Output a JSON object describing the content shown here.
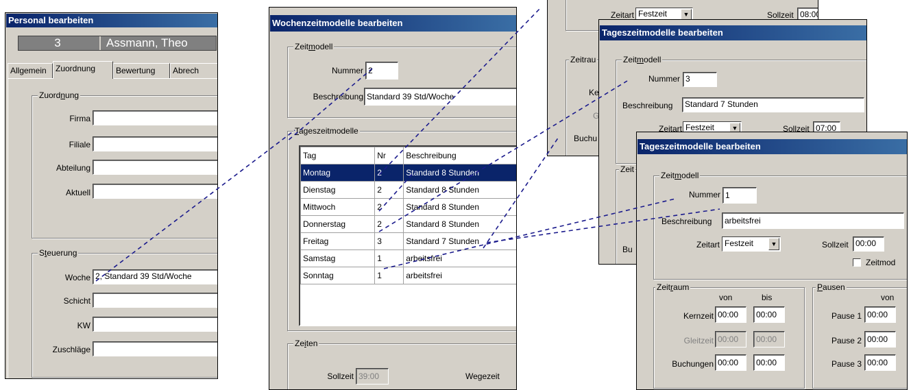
{
  "personal": {
    "title": "Personal bearbeiten",
    "number": "3",
    "name": "Assmann, Theo",
    "tabs": [
      "Allgemein",
      "Zuordnung",
      "Bewertung",
      "Abrech"
    ],
    "zuordnung_group": "Zuordnung",
    "fields": [
      {
        "label": "Firma",
        "value": ""
      },
      {
        "label": "Filiale",
        "value": ""
      },
      {
        "label": "Abteilung",
        "value": ""
      },
      {
        "label": "Aktuell",
        "value": ""
      }
    ],
    "steuerung_group": "Steuerung",
    "steuerung": [
      {
        "label": "Woche",
        "value": "2, Standard 39 Std/Woche"
      },
      {
        "label": "Schicht",
        "value": ""
      },
      {
        "label": "KW",
        "value": ""
      },
      {
        "label": "Zuschläge",
        "value": ""
      }
    ]
  },
  "woche": {
    "title": "Wochenzeitmodelle bearbeiten",
    "zeitmodell_group": "Zeitmodell",
    "nummer_label": "Nummer",
    "nummer_value": "2",
    "beschreibung_label": "Beschreibung",
    "beschreibung_value": "Standard 39 Std/Woche",
    "tageszeit_group": "Tageszeitmodelle",
    "columns": [
      "Tag",
      "Nr",
      "Beschreibung"
    ],
    "rows": [
      {
        "tag": "Montag",
        "nr": "2",
        "beschreibung": "Standard 8 Stunden"
      },
      {
        "tag": "Dienstag",
        "nr": "2",
        "beschreibung": "Standard 8 Stunden"
      },
      {
        "tag": "Mittwoch",
        "nr": "2",
        "beschreibung": "Standard 8 Stunden"
      },
      {
        "tag": "Donnerstag",
        "nr": "2",
        "beschreibung": "Standard 8 Stunden"
      },
      {
        "tag": "Freitag",
        "nr": "3",
        "beschreibung": "Standard 7 Stunden"
      },
      {
        "tag": "Samstag",
        "nr": "1",
        "beschreibung": "arbeitsfrei"
      },
      {
        "tag": "Sonntag",
        "nr": "1",
        "beschreibung": "arbeitsfrei"
      }
    ],
    "zeiten_group": "Zeiten",
    "sollzeit_label": "Sollzeit",
    "sollzeit_value": "39:00",
    "wegezeit_label": "Wegezeit"
  },
  "tag_back": {
    "zeitart_label": "Zeitart",
    "zeitart_value": "Festzeit",
    "sollzeit_label": "Sollzeit",
    "sollzeit_value": "08:00",
    "zeitraum_partial": "Zeitrau",
    "kern_partial": "Ke",
    "gleit_partial": "Gl",
    "buchungen_partial": "Buchu"
  },
  "tag_mid": {
    "title": "Tageszeitmodelle bearbeiten",
    "zeitmodell_group": "Zeitmodell",
    "nummer_label": "Nummer",
    "nummer_value": "3",
    "beschreibung_label": "Beschreibung",
    "beschreibung_value": "Standard 7 Stunden",
    "zeitart_label": "Zeitart",
    "zeitart_value": "Festzeit",
    "sollzeit_label": "Sollzeit",
    "sollzeit_value": "07:00",
    "zeitraum_partial": "Zeit",
    "buchungen_partial": "Bu"
  },
  "tag_front": {
    "title": "Tageszeitmodelle bearbeiten",
    "zeitmodell_group": "Zeitmodell",
    "nummer_label": "Nummer",
    "nummer_value": "1",
    "beschreibung_label": "Beschreibung",
    "beschreibung_value": "arbeitsfrei",
    "zeitart_label": "Zeitart",
    "zeitart_value": "Festzeit",
    "sollzeit_label": "Sollzeit",
    "sollzeit_value": "00:00",
    "checkbox_label": "Zeitmod",
    "zeitraum_group": "Zeitraum",
    "von_label": "von",
    "bis_label": "bis",
    "kernzeit_label": "Kernzeit",
    "kernzeit_von": "00:00",
    "kernzeit_bis": "00:00",
    "gleitzeit_label": "Gleitzeit",
    "gleitzeit_von": "00:00",
    "gleitzeit_bis": "00:00",
    "buchungen_label": "Buchungen",
    "buchungen_von": "00:00",
    "buchungen_bis": "00:00",
    "pausen_group": "Pausen",
    "pausen_von_label": "von",
    "pause1_label": "Pause 1",
    "pause1_von": "00:00",
    "pause2_label": "Pause 2",
    "pause2_von": "00:00",
    "pause3_label": "Pause 3",
    "pause3_von": "00:00"
  }
}
